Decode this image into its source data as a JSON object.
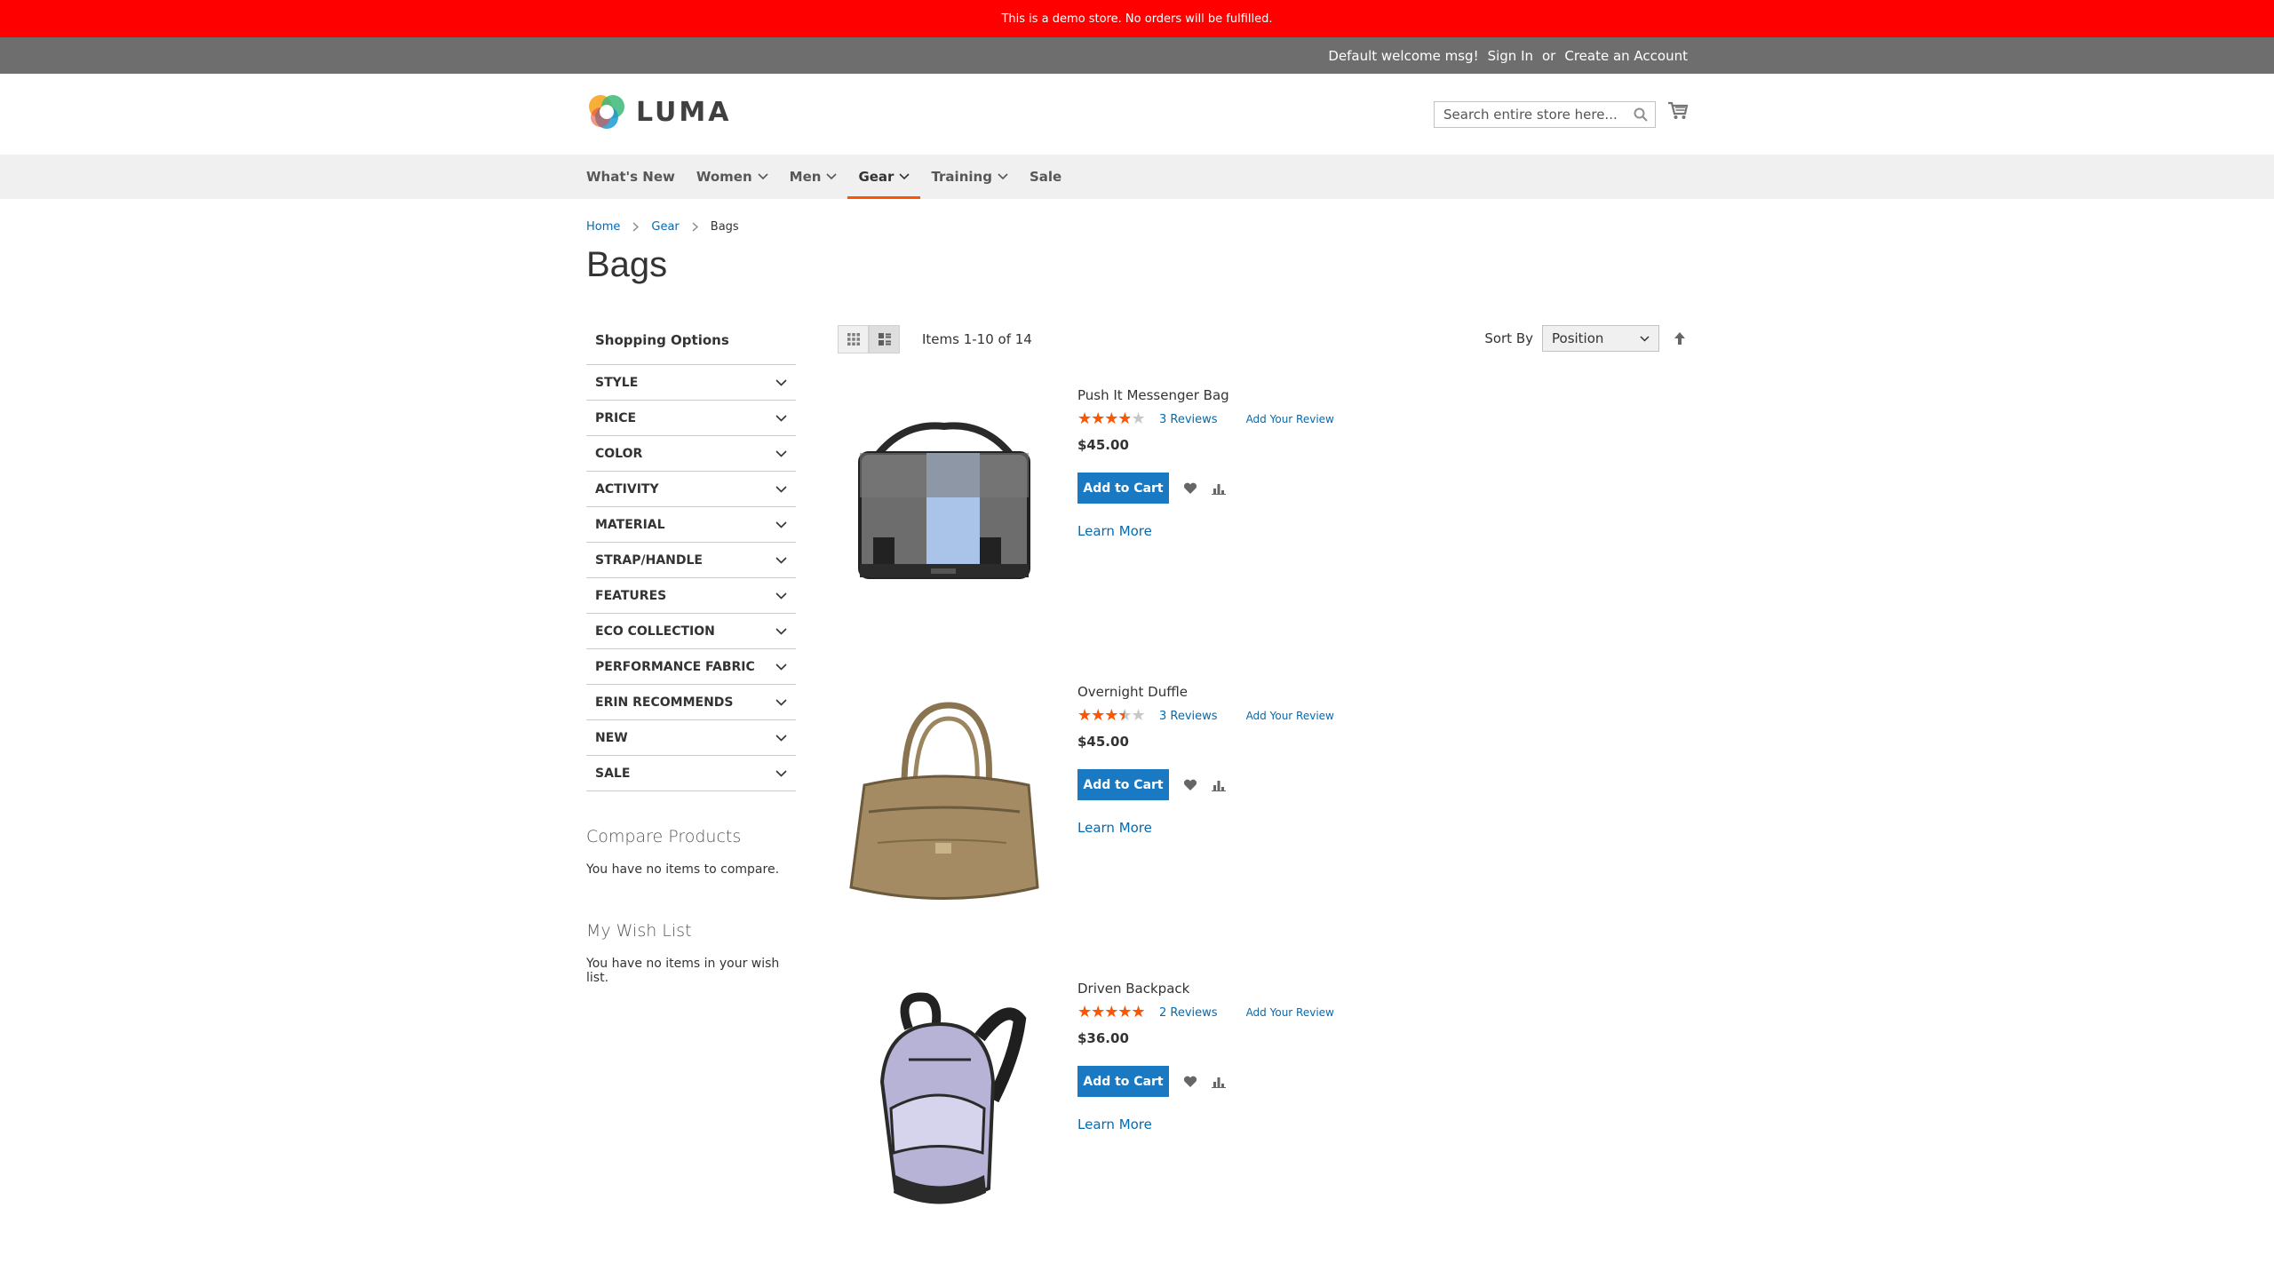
{
  "demo_notice": "This is a demo store. No orders will be fulfilled.",
  "panel": {
    "welcome": "Default welcome msg!",
    "sign_in": "Sign In",
    "or": "or",
    "create_account": "Create an Account"
  },
  "header": {
    "logo_text": "LUMA",
    "search_placeholder": "Search entire store here...",
    "cart_icon": "cart-icon"
  },
  "nav": [
    {
      "label": "What's New",
      "has_dropdown": false,
      "active": false
    },
    {
      "label": "Women",
      "has_dropdown": true,
      "active": false
    },
    {
      "label": "Men",
      "has_dropdown": true,
      "active": false
    },
    {
      "label": "Gear",
      "has_dropdown": true,
      "active": true
    },
    {
      "label": "Training",
      "has_dropdown": true,
      "active": false
    },
    {
      "label": "Sale",
      "has_dropdown": false,
      "active": false
    }
  ],
  "breadcrumbs": {
    "home": "Home",
    "gear": "Gear",
    "current": "Bags"
  },
  "page_title": "Bags",
  "sidebar": {
    "title": "Shopping Options",
    "filters": [
      "STYLE",
      "PRICE",
      "COLOR",
      "ACTIVITY",
      "MATERIAL",
      "STRAP/HANDLE",
      "FEATURES",
      "ECO COLLECTION",
      "PERFORMANCE FABRIC",
      "ERIN RECOMMENDS",
      "NEW",
      "SALE"
    ],
    "compare_title": "Compare Products",
    "compare_text": "You have no items to compare.",
    "wishlist_title": "My Wish List",
    "wishlist_text": "You have no items in your wish list."
  },
  "toolbar": {
    "amount": "Items 1-10 of 14",
    "sort_label": "Sort By",
    "sort_value": "Position",
    "mode": "list"
  },
  "products": [
    {
      "name": "Push It Messenger Bag",
      "rating_percent": 67,
      "reviews": "3  Reviews",
      "add_review": "Add Your Review",
      "price": "$45.00",
      "add_to_cart": "Add to Cart",
      "learn_more": "Learn More"
    },
    {
      "name": "Overnight Duffle",
      "rating_percent": 60,
      "reviews": "3  Reviews",
      "add_review": "Add Your Review",
      "price": "$45.00",
      "add_to_cart": "Add to Cart",
      "learn_more": "Learn More"
    },
    {
      "name": "Driven Backpack",
      "rating_percent": 90,
      "reviews": "2  Reviews",
      "add_review": "Add Your Review",
      "price": "$36.00",
      "add_to_cart": "Add to Cart",
      "learn_more": "Learn More"
    }
  ],
  "colors": {
    "demo_bar": "#ff0000",
    "panel": "#6e6e6e",
    "nav_bg": "#f0f0f0",
    "accent": "#ff5501",
    "link": "#006bb4",
    "button": "#1979c3"
  }
}
